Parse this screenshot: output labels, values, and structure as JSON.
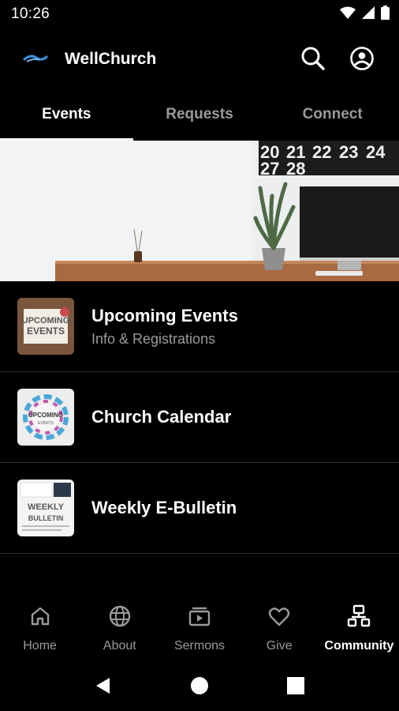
{
  "status_bar": {
    "time": "10:26",
    "icons": [
      "wifi-icon",
      "cell-signal-icon",
      "battery-icon"
    ]
  },
  "app": {
    "title": "WellChurch",
    "logo": "wellchurch-logo"
  },
  "appbar": {
    "actions": [
      "search-icon",
      "account-icon"
    ]
  },
  "tabs": [
    {
      "label": "Events",
      "active": true
    },
    {
      "label": "Requests",
      "active": false
    },
    {
      "label": "Connect",
      "active": false
    }
  ],
  "banner": {
    "calendar_numbers": [
      "20",
      "21",
      "22",
      "23",
      "24",
      "27",
      "28"
    ]
  },
  "list": [
    {
      "title": "Upcoming Events",
      "subtitle": "Info & Registrations",
      "thumb_text": [
        "UPCOMING",
        "EVENTS"
      ]
    },
    {
      "title": "Church Calendar",
      "subtitle": "",
      "thumb_text": [
        "UPCOMING",
        "EVENTS"
      ]
    },
    {
      "title": "Weekly E-Bulletin",
      "subtitle": "",
      "thumb_text": [
        "WEEKLY",
        "BULLETIN"
      ]
    }
  ],
  "bottom_nav": [
    {
      "label": "Home",
      "icon": "home-icon",
      "active": false
    },
    {
      "label": "About",
      "icon": "globe-icon",
      "active": false
    },
    {
      "label": "Sermons",
      "icon": "video-library-icon",
      "active": false
    },
    {
      "label": "Give",
      "icon": "heart-icon",
      "active": false
    },
    {
      "label": "Community",
      "icon": "community-icon",
      "active": true
    }
  ],
  "system_nav": [
    "back-icon",
    "home-circle-icon",
    "recents-icon"
  ],
  "colors": {
    "background": "#000000",
    "text": "#ffffff",
    "muted": "#9a9a9a",
    "divider": "#2c2c2c",
    "logo_accent": "#3b8fd9"
  }
}
